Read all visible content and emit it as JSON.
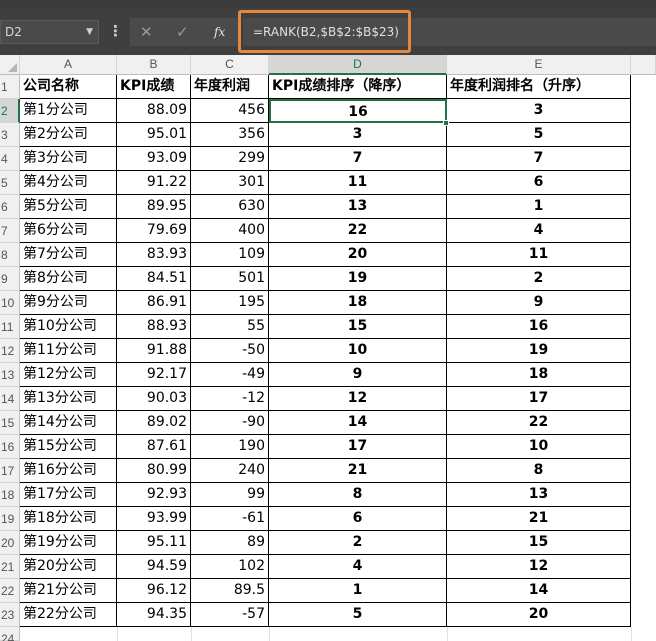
{
  "formula_bar": {
    "name_box": "D2",
    "cancel_glyph": "✕",
    "enter_glyph": "✓",
    "fx_label": "fx",
    "formula": "=RANK(B2,$B$2:$B$23)"
  },
  "columns": [
    "A",
    "B",
    "C",
    "D",
    "E"
  ],
  "active_cell": {
    "column": "D",
    "row": 2
  },
  "header_row": {
    "row_number": "1",
    "a": "公司名称",
    "b": "KPI成绩",
    "c": "年度利润",
    "d": "KPI成绩排序（降序）",
    "e": "年度利润排名（升序）"
  },
  "rows": [
    {
      "n": "2",
      "a": "第1分公司",
      "b": "88.09",
      "c": "456",
      "d": "16",
      "e": "3"
    },
    {
      "n": "3",
      "a": "第2分公司",
      "b": "95.01",
      "c": "356",
      "d": "3",
      "e": "5"
    },
    {
      "n": "4",
      "a": "第3分公司",
      "b": "93.09",
      "c": "299",
      "d": "7",
      "e": "7"
    },
    {
      "n": "5",
      "a": "第4分公司",
      "b": "91.22",
      "c": "301",
      "d": "11",
      "e": "6"
    },
    {
      "n": "6",
      "a": "第5分公司",
      "b": "89.95",
      "c": "630",
      "d": "13",
      "e": "1"
    },
    {
      "n": "7",
      "a": "第6分公司",
      "b": "79.69",
      "c": "400",
      "d": "22",
      "e": "4"
    },
    {
      "n": "8",
      "a": "第7分公司",
      "b": "83.93",
      "c": "109",
      "d": "20",
      "e": "11"
    },
    {
      "n": "9",
      "a": "第8分公司",
      "b": "84.51",
      "c": "501",
      "d": "19",
      "e": "2"
    },
    {
      "n": "10",
      "a": "第9分公司",
      "b": "86.91",
      "c": "195",
      "d": "18",
      "e": "9"
    },
    {
      "n": "11",
      "a": "第10分公司",
      "b": "88.93",
      "c": "55",
      "d": "15",
      "e": "16"
    },
    {
      "n": "12",
      "a": "第11分公司",
      "b": "91.88",
      "c": "-50",
      "d": "10",
      "e": "19"
    },
    {
      "n": "13",
      "a": "第12分公司",
      "b": "92.17",
      "c": "-49",
      "d": "9",
      "e": "18"
    },
    {
      "n": "14",
      "a": "第13分公司",
      "b": "90.03",
      "c": "-12",
      "d": "12",
      "e": "17"
    },
    {
      "n": "15",
      "a": "第14分公司",
      "b": "89.02",
      "c": "-90",
      "d": "14",
      "e": "22"
    },
    {
      "n": "16",
      "a": "第15分公司",
      "b": "87.61",
      "c": "190",
      "d": "17",
      "e": "10"
    },
    {
      "n": "17",
      "a": "第16分公司",
      "b": "80.99",
      "c": "240",
      "d": "21",
      "e": "8"
    },
    {
      "n": "18",
      "a": "第17分公司",
      "b": "92.93",
      "c": "99",
      "d": "8",
      "e": "13"
    },
    {
      "n": "19",
      "a": "第18分公司",
      "b": "93.99",
      "c": "-61",
      "d": "6",
      "e": "21"
    },
    {
      "n": "20",
      "a": "第19分公司",
      "b": "95.11",
      "c": "89",
      "d": "2",
      "e": "15"
    },
    {
      "n": "21",
      "a": "第20分公司",
      "b": "94.59",
      "c": "102",
      "d": "4",
      "e": "12"
    },
    {
      "n": "22",
      "a": "第21分公司",
      "b": "96.12",
      "c": "89.5",
      "d": "1",
      "e": "14"
    },
    {
      "n": "23",
      "a": "第22分公司",
      "b": "94.35",
      "c": "-57",
      "d": "5",
      "e": "20"
    }
  ],
  "tail_row_number": "24",
  "colors": {
    "accent_green": "#217346",
    "highlight_orange": "#e8873a"
  }
}
